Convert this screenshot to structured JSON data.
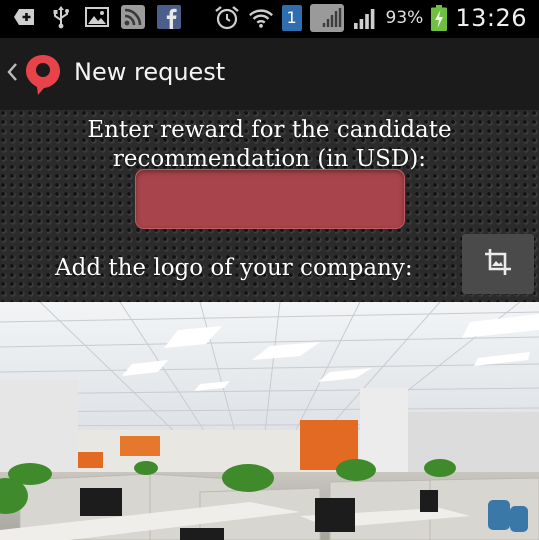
{
  "statusbar": {
    "left_icons": [
      "add-notification-icon",
      "usb-icon",
      "image-icon",
      "rss-icon",
      "facebook-icon"
    ],
    "right_icons": [
      "alarm-icon",
      "wifi-icon",
      "sim-badge-icon",
      "gallery-icon",
      "signal-icon",
      "battery-charging-icon"
    ],
    "sim_number": "1",
    "battery": "93%",
    "time": "13:26"
  },
  "actionbar": {
    "title": "New request"
  },
  "form": {
    "reward_label": "Enter reward for the candidate recommendation (in USD):",
    "reward_value": "",
    "reward_placeholder": "",
    "logo_label": "Add the logo of your company:"
  },
  "colors": {
    "input_fill": "#a8444b",
    "brand_red": "#e8434a",
    "action_bar": "#1b1b1b"
  },
  "photo": {
    "subject": "office-interior-image"
  }
}
